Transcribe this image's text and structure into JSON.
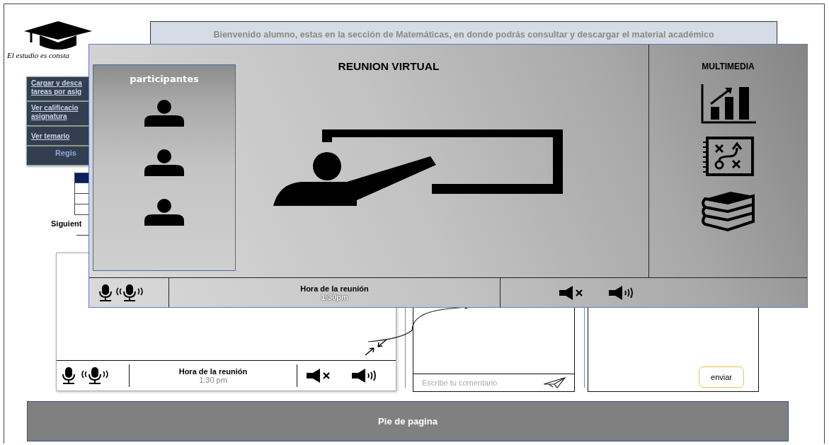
{
  "logo": {
    "tagline": "El estudio es consta"
  },
  "banner": {
    "text": "Bienvenido alumno, estas en la sección de Matemáticas, en donde podrás consultar y descargar el material académico"
  },
  "sidebar": {
    "items": [
      {
        "lines": [
          "Cargar y desca",
          "tareas por asig"
        ]
      },
      {
        "lines": [
          "Ver calificacio",
          "asignatura"
        ]
      },
      {
        "lines": [
          "Ver temario"
        ]
      }
    ],
    "footer": "Regis"
  },
  "next_label": "Siguient",
  "video_panel": {
    "meeting_label": "Hora de la reunión",
    "meeting_time": "1:30 pm"
  },
  "comment_box": {
    "placeholder": "Escribe tu comentario"
  },
  "reply_box": {
    "button": "enviar"
  },
  "footer": "Pie de pagina",
  "meeting_window": {
    "title": "REUNION VIRTUAL",
    "participants_title": "participantes",
    "participants": [
      {
        "kind": "person"
      },
      {
        "kind": "person"
      },
      {
        "kind": "person"
      }
    ],
    "multimedia_title": "MULTIMEDIA",
    "multimedia": [
      {
        "kind": "chart"
      },
      {
        "kind": "notebook"
      },
      {
        "kind": "books"
      }
    ],
    "meeting_label": "Hora de la reunión",
    "meeting_time": "1:30pm"
  }
}
